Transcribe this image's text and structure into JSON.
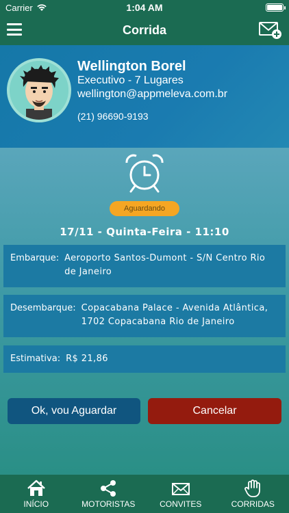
{
  "status_bar": {
    "carrier": "Carrier",
    "time": "1:04 AM"
  },
  "nav": {
    "title": "Corrida",
    "menu_icon": "hamburger-menu-icon",
    "action_icon": "mail-add-icon"
  },
  "driver": {
    "name": "Wellington Borel",
    "category": "Executivo - 7 Lugares",
    "email": "wellington@appmeleva.com.br",
    "phone": "(21) 96690-9193"
  },
  "ride": {
    "status": "Aguardando",
    "datetime": "17/11 - Quinta-Feira - 11:10",
    "pickup_label": "Embarque:",
    "pickup": "Aeroporto Santos-Dumont - S/N Centro Rio de Janeiro",
    "dropoff_label": "Desembarque:",
    "dropoff": "Copacabana Palace - Avenida Atlântica, 1702 Copacabana Rio de Janeiro",
    "estimate_label": "Estimativa:",
    "estimate": "R$ 21,86"
  },
  "actions": {
    "ok_label": "Ok, vou Aguardar",
    "cancel_label": "Cancelar"
  },
  "tabs": [
    {
      "label": "INÍCIO",
      "icon": "home-icon"
    },
    {
      "label": "MOTORISTAS",
      "icon": "share-icon"
    },
    {
      "label": "CONVITES",
      "icon": "envelope-icon"
    },
    {
      "label": "CORRIDAS",
      "icon": "hand-icon"
    }
  ],
  "colors": {
    "header_green": "#1b6b52",
    "profile_blue": "#1a7bb0",
    "status_orange": "#f5a623",
    "ok_blue": "#10557f",
    "cancel_red": "#941b0e"
  }
}
